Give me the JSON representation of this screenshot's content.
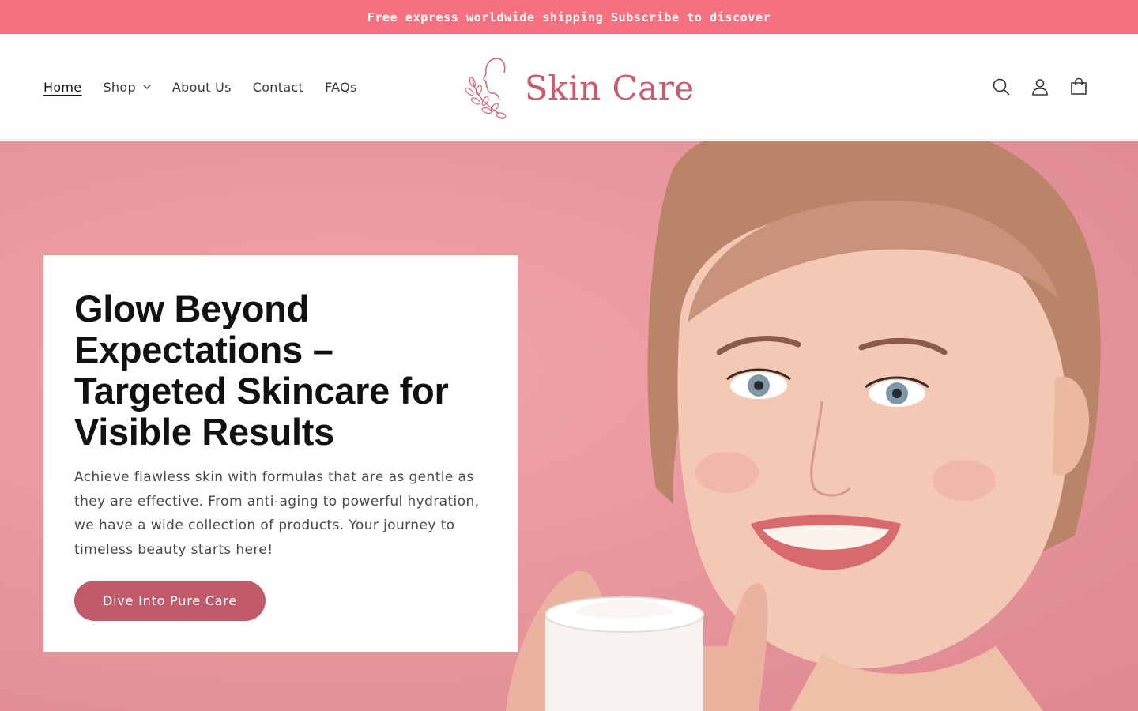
{
  "announcement": {
    "text": "Free express worldwide shipping Subscribe to discover"
  },
  "nav": {
    "items": [
      {
        "label": "Home",
        "active": true
      },
      {
        "label": "Shop",
        "has_dropdown": true
      },
      {
        "label": "About Us"
      },
      {
        "label": "Contact"
      },
      {
        "label": "FAQs"
      }
    ]
  },
  "logo": {
    "text": "Skin Care",
    "mark_icon": "face-leaf-logo-icon"
  },
  "header_icons": [
    "search-icon",
    "account-icon",
    "cart-icon"
  ],
  "hero": {
    "title": "Glow Beyond Expectations – Targeted Skincare for Visible Results",
    "description": "Achieve flawless skin with formulas that are as gentle as they are effective. From anti-aging to powerful hydration, we have a wide collection of products. Your journey to timeless beauty starts here!",
    "button_label": "Dive Into Pure Care"
  },
  "colors": {
    "announcement_bg": "#f7707f",
    "brand": "#c85d6d",
    "button_bg": "#c25b69",
    "hero_bg": "#e9979e"
  }
}
